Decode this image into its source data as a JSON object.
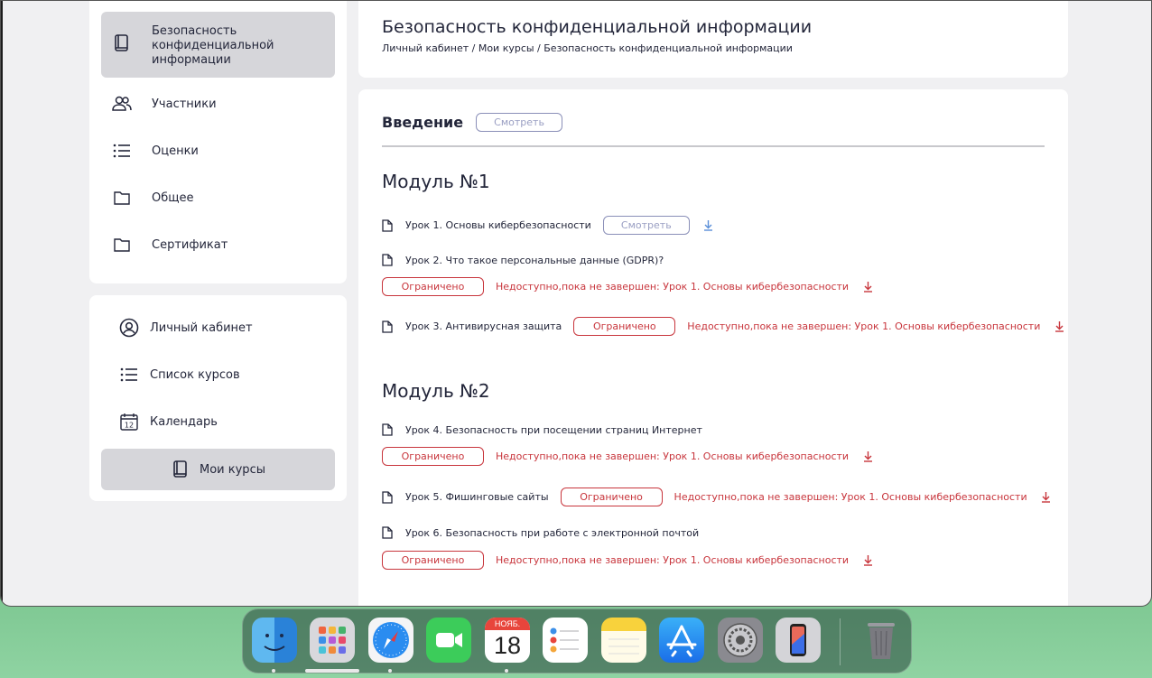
{
  "sidebar": {
    "items": [
      {
        "label": "Безопасность конфиденциальной информации",
        "icon": "book-icon",
        "active": true
      },
      {
        "label": "Участники",
        "icon": "users-icon"
      },
      {
        "label": "Оценки",
        "icon": "list-icon"
      },
      {
        "label": "Общее",
        "icon": "folder-icon"
      },
      {
        "label": "Сертификат",
        "icon": "folder-icon"
      }
    ],
    "nav": [
      {
        "label": "Личный кабинет",
        "icon": "user-circle-icon"
      },
      {
        "label": "Список курсов",
        "icon": "list-icon"
      },
      {
        "label": "Календарь",
        "icon": "calendar-icon",
        "day": "12"
      },
      {
        "label": "Мои курсы",
        "icon": "book-icon",
        "active": true
      }
    ]
  },
  "header": {
    "title": "Безопасность конфиденциальной информации",
    "breadcrumb": "Личный кабинет / Мои курсы / Безопасность конфиденциальной информации"
  },
  "main": {
    "intro": {
      "title": "Введение",
      "button": "Смотреть"
    },
    "modules": [
      {
        "title": "Модуль №1",
        "lessons": [
          {
            "title": "Урок 1. Основы кибербезопасности",
            "button": "Смотреть"
          },
          {
            "title": "Урок 2. Что такое персональные данные (GDPR)?",
            "status": "Ограничено",
            "warning": "Недоступно,пока не завершен: Урок 1. Основы кибербезопасности"
          },
          {
            "title": "Урок 3. Антивирусная защита",
            "status": "Ограничено",
            "warning": "Недоступно,пока не завершен: Урок 1. Основы кибербезопасности"
          }
        ]
      },
      {
        "title": "Модуль №2",
        "lessons": [
          {
            "title": "Урок 4. Безопасность при посещении страниц Интернет",
            "status": "Ограничено",
            "warning": "Недоступно,пока не завершен: Урок 1. Основы кибербезопасности"
          },
          {
            "title": "Урок 5. Фишинговые сайты",
            "status": "Ограничено",
            "warning": "Недоступно,пока не завершен: Урок 1. Основы кибербезопасности"
          },
          {
            "title": "Урок 6. Безопасность при работе с электронной почтой",
            "status": "Ограничено",
            "warning": "Недоступно,пока не завершен: Урок 1. Основы кибербезопасности"
          }
        ]
      }
    ]
  },
  "dock": {
    "apps": [
      "finder-icon",
      "launchpad-icon",
      "safari-icon",
      "facetime-icon",
      "calendar-app-icon",
      "reminders-icon",
      "notes-icon",
      "app-store-icon",
      "system-settings-icon",
      "iphone-mirroring-icon",
      "trash-icon"
    ],
    "calendar_month": "НОЯБ.",
    "calendar_day": "18"
  },
  "colors": {
    "accent_red": "#c8353c",
    "view_border": "#8a8fb8",
    "active_bg": "#d6d6da"
  }
}
